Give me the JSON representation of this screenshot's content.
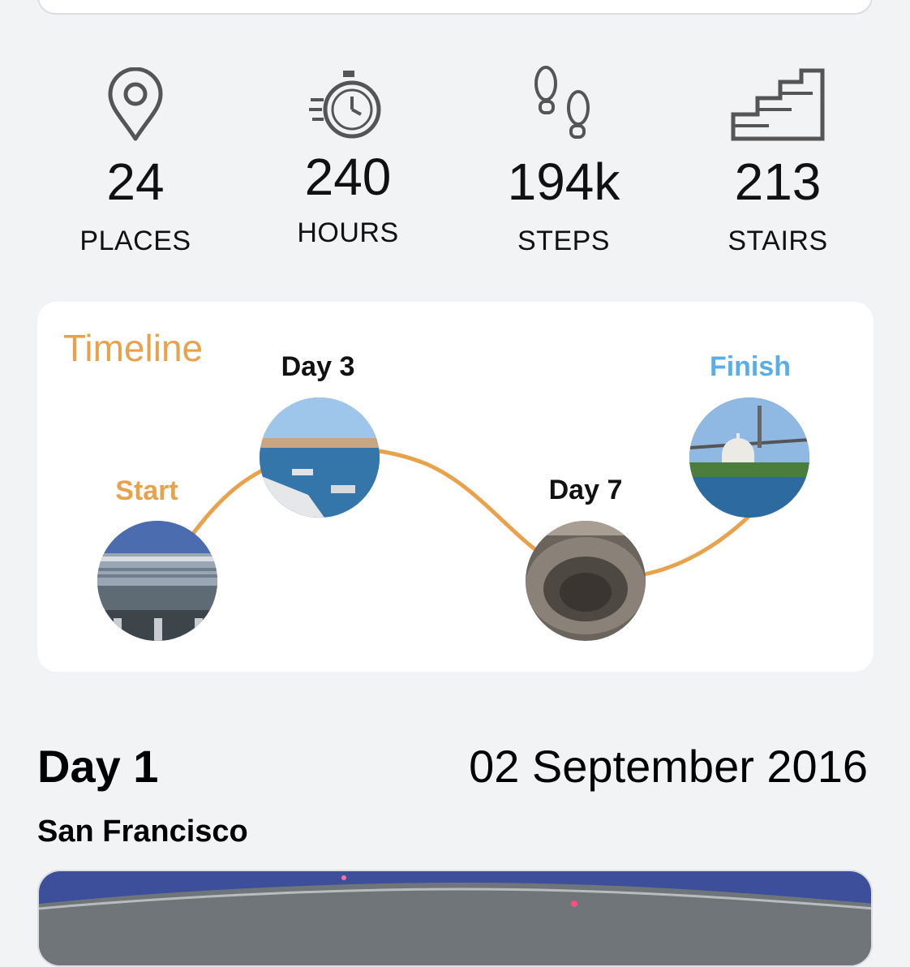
{
  "stats": [
    {
      "icon": "map-pin-icon",
      "value": "24",
      "label": "PLACES"
    },
    {
      "icon": "stopwatch-icon",
      "value": "240",
      "label": "HOURS"
    },
    {
      "icon": "footsteps-icon",
      "value": "194k",
      "label": "STEPS"
    },
    {
      "icon": "stairs-icon",
      "value": "213",
      "label": "STAIRS"
    }
  ],
  "timeline": {
    "title": "Timeline",
    "nodes": [
      {
        "label": "Start",
        "color": "#e9a24c",
        "photo": "san-francisco-airport"
      },
      {
        "label": "Day 3",
        "color": "#111111",
        "photo": "venice-waterfront"
      },
      {
        "label": "Day 7",
        "color": "#111111",
        "photo": "colosseum"
      },
      {
        "label": "Finish",
        "color": "#5aaee8",
        "photo": "istanbul-bosphorus-mosque"
      }
    ],
    "line_color": "#e9a24c"
  },
  "day": {
    "title": "Day 1",
    "date": "02 September 2016",
    "city": "San Francisco"
  },
  "colors": {
    "background": "#f2f3f5",
    "card": "#ffffff",
    "accent_orange": "#e9a24c",
    "accent_blue": "#5aaee8"
  }
}
